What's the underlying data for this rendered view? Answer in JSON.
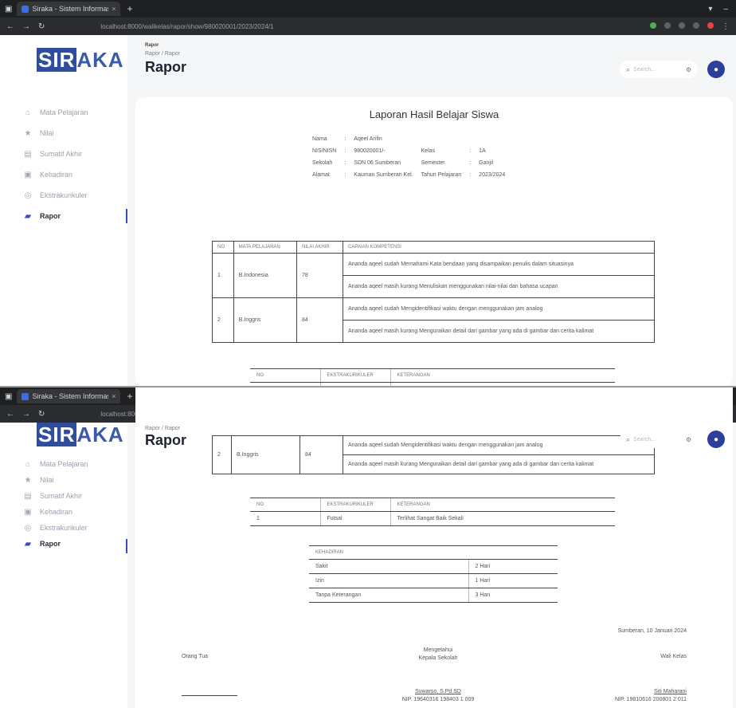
{
  "browser": {
    "tab_title": "Siraka - Sistem Informasi R...",
    "tab_close": "×",
    "new_tab": "+",
    "url": "localhost:8000/walikelas/rapor/show/980020001/2023/2024/1",
    "menu_icon": "⋮"
  },
  "sidebar": {
    "logo_highlight": "SIR",
    "logo_rest": "AKA",
    "items": [
      {
        "label": "Mata Pelajaran",
        "icon": "home-icon",
        "glyph": "⌂"
      },
      {
        "label": "Nilai",
        "icon": "star-icon",
        "glyph": "★"
      },
      {
        "label": "Sumatif Akhir",
        "icon": "document-icon",
        "glyph": "▤"
      },
      {
        "label": "Kehadiran",
        "icon": "calendar-icon",
        "glyph": "▣"
      },
      {
        "label": "Ekstrakurikuler",
        "icon": "ball-icon",
        "glyph": "◎"
      },
      {
        "label": "Rapor",
        "icon": "book-icon",
        "glyph": "▰",
        "active": true
      }
    ]
  },
  "header": {
    "crumb_sup": "Rapor",
    "breadcrumb": "Rapor / Rapor",
    "title": "Rapor",
    "search_placeholder": "Search...",
    "avatar_glyph": "●"
  },
  "report": {
    "title": "Laporan Hasil Belajar Siswa",
    "info": [
      {
        "label": "Nama",
        "value": "Aqeel Arifin",
        "label2": "",
        "value2": ""
      },
      {
        "label": "NIS/NISN",
        "value": "980020001/-",
        "label2": "Kelas",
        "value2": "1A"
      },
      {
        "label": "Sekolah",
        "value": "SDN 06 Sumberan",
        "label2": "Semester",
        "value2": "Ganjil"
      },
      {
        "label": "Alamat",
        "value": "Kauman Sumberan Kel.",
        "label2": "Tahun Pelajaran",
        "value2": "2023/2024"
      }
    ],
    "grades_headers": [
      "NO",
      "MATA PELAJARAN",
      "NILAI AKHIR",
      "CAPAIAN KOMPETENSI"
    ],
    "grades": [
      {
        "no": "1",
        "subject": "B.Indonesia",
        "score": "78",
        "c1": "Ananda aqeel sudah Memahami Kata bendaan yang disampaikan penulis dalam situasinya",
        "c2": "Ananda aqeel masih kurang Menuliskan menggunakan nilai-nilai dan bahasa ucapan"
      },
      {
        "no": "2",
        "subject": "B.Inggris",
        "score": "84",
        "c1": "Ananda aqeel sudah Mengidentifikasi waktu dengan menggunakan jam analog",
        "c2": "Ananda aqeel masih kurang Menguraikan detail dari gambar yang ada di gambar dan cerita kalimat"
      }
    ],
    "ekskul_headers": [
      "NO",
      "EKSTRAKURIKULER",
      "KETERANGAN"
    ],
    "ekskul": [
      {
        "no": "1",
        "name": "Futsal",
        "desc": "Terlihat Sangat Baik Sekali"
      }
    ],
    "attendance_header": "KEHADIRAN",
    "attendance": [
      {
        "label": "Sakit",
        "value": "2 Hari"
      },
      {
        "label": "Izin",
        "value": "1 Hari"
      },
      {
        "label": "Tanpa Keterangan",
        "value": "3 Hari"
      }
    ],
    "place_date": "Sumberan, 10 Januari 2024",
    "sig_parent": "Orang Tua",
    "sig_head_title": "Mengetahui",
    "sig_head_role": "Kepala Sekolah",
    "sig_teacher": "Wali Kelas",
    "head_name": "Suwarso, S.Pd.SD",
    "head_nip": "NIP. 19640316 198403 1 009",
    "teacher_name": "Siti Maharani",
    "teacher_nip": "NIP. 19810616 200801 2 011"
  }
}
